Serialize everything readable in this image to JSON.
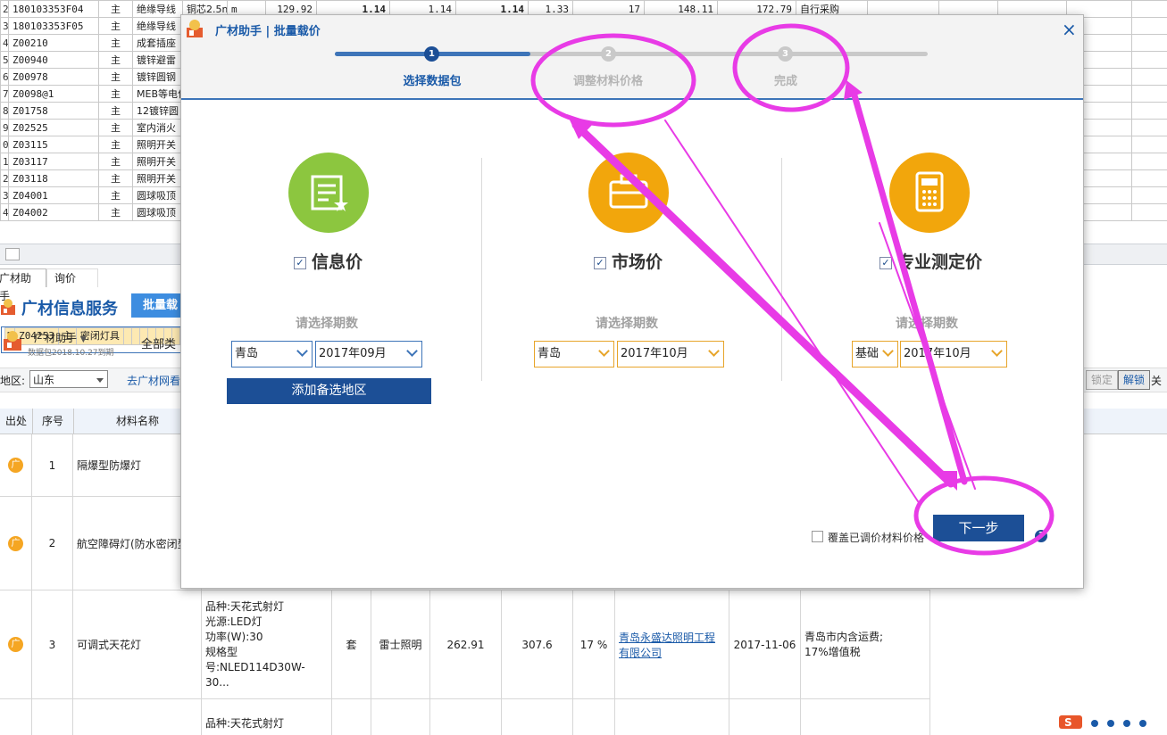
{
  "top_grid": {
    "rows": [
      {
        "n": "2",
        "code": "180103353F04",
        "type": "主",
        "name": "绝缘导线",
        "spec": "铜芯2.5mm2",
        "unit": "m",
        "c1": "129.92",
        "c2": "1.14",
        "c3": "1.14",
        "c4": "1.14",
        "c5": "1.33",
        "c6": "17",
        "c7": "148.11",
        "c8": "172.79",
        "c9": "自行采购",
        "c10": "0"
      },
      {
        "n": "3",
        "code": "180103353F05",
        "type": "主",
        "name": "绝缘导线",
        "c10": "0"
      },
      {
        "n": "4",
        "code": "Z00210",
        "type": "主",
        "name": "成套插座",
        "c10": "0"
      },
      {
        "n": "5",
        "code": "Z00940",
        "type": "主",
        "name": "镀锌避雷",
        "c10": "0"
      },
      {
        "n": "6",
        "code": "Z00978",
        "type": "主",
        "name": "镀锌圆钢",
        "c10": "0"
      },
      {
        "n": "7",
        "code": "Z0098@1",
        "type": "主",
        "name": "MEB等电位",
        "c10": "0"
      },
      {
        "n": "8",
        "code": "Z01758",
        "type": "主",
        "name": "12镀锌圆",
        "c10": "0"
      },
      {
        "n": "9",
        "code": "Z02525",
        "type": "主",
        "name": "室内消火",
        "c10": "0"
      },
      {
        "n": "0",
        "code": "Z03115",
        "type": "主",
        "name": "照明开关",
        "c10": "0"
      },
      {
        "n": "1",
        "code": "Z03117",
        "type": "主",
        "name": "照明开关",
        "c10": "0"
      },
      {
        "n": "2",
        "code": "Z03118",
        "type": "主",
        "name": "照明开关",
        "c10": "0"
      },
      {
        "n": "3",
        "code": "Z04001",
        "type": "主",
        "name": "圆球吸顶",
        "c10": "0"
      },
      {
        "n": "4",
        "code": "Z04002",
        "type": "主",
        "name": "圆球吸顶",
        "c10": "0"
      },
      {
        "n": "5",
        "code": "Z04253",
        "type": "主",
        "name": "密闭灯具",
        "c10": "0"
      }
    ]
  },
  "bottom": {
    "tabs": [
      "广材助手",
      "询价"
    ],
    "brand_title": "广材信息服务",
    "batch_button": "批量载",
    "user": "广材助手",
    "data_date": "数据包2018.10.27到期",
    "all_category": "全部类",
    "region_label": "地区:",
    "region_value": "山东",
    "goto_link": "去广材网看",
    "lock": "锁定",
    "unlock": "解锁",
    "close": "关",
    "headers": [
      "出处",
      "序号",
      "材料名称"
    ],
    "rows": [
      {
        "seq": "1",
        "name": "隔爆型防爆灯"
      },
      {
        "seq": "2",
        "name": "航空障碍灯(防水密闭型"
      },
      {
        "seq": "3",
        "name": "可调式天花灯",
        "spec": "品种:天花式射灯\n光源:LED灯\n功率(W):30\n规格型号:NLED114D30W-30...",
        "unit": "套",
        "brand": "雷士照明",
        "price1": "262.91",
        "price2": "307.6",
        "tax": "17 %",
        "supplier": "青岛永盛达照明工程有限公司",
        "date": "2017-11-06",
        "note": "青岛市内含运费;\n17%增值税"
      },
      {
        "seq": "",
        "spec": "品种:天花式射灯"
      }
    ],
    "gicon_text": "广"
  },
  "modal": {
    "title": "广材助手 | 批量载价",
    "close_symbol": "×",
    "steps": [
      {
        "num": "1",
        "label": "选择数据包",
        "active": true
      },
      {
        "num": "2",
        "label": "调整材料价格",
        "active": false
      },
      {
        "num": "3",
        "label": "完成",
        "active": false
      }
    ],
    "progress": 0.33,
    "columns": [
      {
        "title": "信息价",
        "checked": true,
        "period": "请选择期数",
        "region": "青岛",
        "month": "2017年09月",
        "color": "#8cc63f"
      },
      {
        "title": "市场价",
        "checked": true,
        "period": "请选择期数",
        "region": "青岛",
        "month": "2017年10月",
        "color": "#f2a60c"
      },
      {
        "title": "专业测定价",
        "checked": true,
        "period": "请选择期数",
        "region": "基础",
        "month": "2017年10月",
        "color": "#f2a60c"
      }
    ],
    "add_region_button": "添加备选地区",
    "overwrite_label": "覆盖已调价材料价格",
    "next_button": "下一步",
    "help_symbol": "?",
    "check_mark": "✓"
  },
  "annotation_color": "#e83be6"
}
